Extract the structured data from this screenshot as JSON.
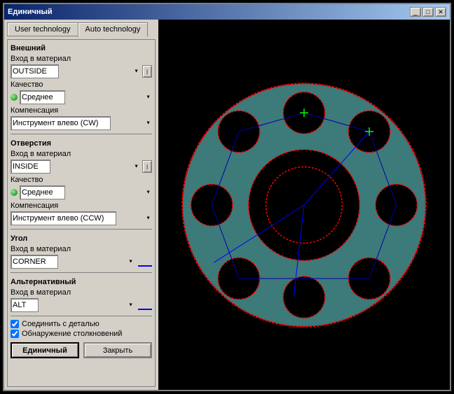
{
  "window": {
    "title": "Единичный",
    "close_btn": "✕",
    "minimize_btn": "_",
    "maximize_btn": "□"
  },
  "tabs": {
    "user_tech": "User technology",
    "auto_tech": "Auto technology"
  },
  "sections": {
    "external": {
      "header": "Внешний",
      "entry_label": "Вход в материал",
      "entry_value": "OUTSIDE",
      "quality_label": "Качество",
      "quality_value": "Среднее",
      "compensation_label": "Компенсация",
      "compensation_value": "Инструмент влево (CW)"
    },
    "holes": {
      "header": "Отверстия",
      "entry_label": "Вход в материал",
      "entry_value": "INSIDE",
      "quality_label": "Качество",
      "quality_value": "Среднее",
      "compensation_label": "Компенсация",
      "compensation_value": "Инструмент влево (CCW)"
    },
    "corner": {
      "header": "Угол",
      "entry_label": "Вход в материал",
      "entry_value": "CORNER"
    },
    "alt": {
      "header": "Альтернативный",
      "entry_label": "Вход в материал",
      "entry_value": "ALT"
    }
  },
  "checkboxes": {
    "connect": "Соединить с деталью",
    "collision": "Обнаружение столкновений"
  },
  "buttons": {
    "primary": "Единичный",
    "close": "Закрыть"
  }
}
